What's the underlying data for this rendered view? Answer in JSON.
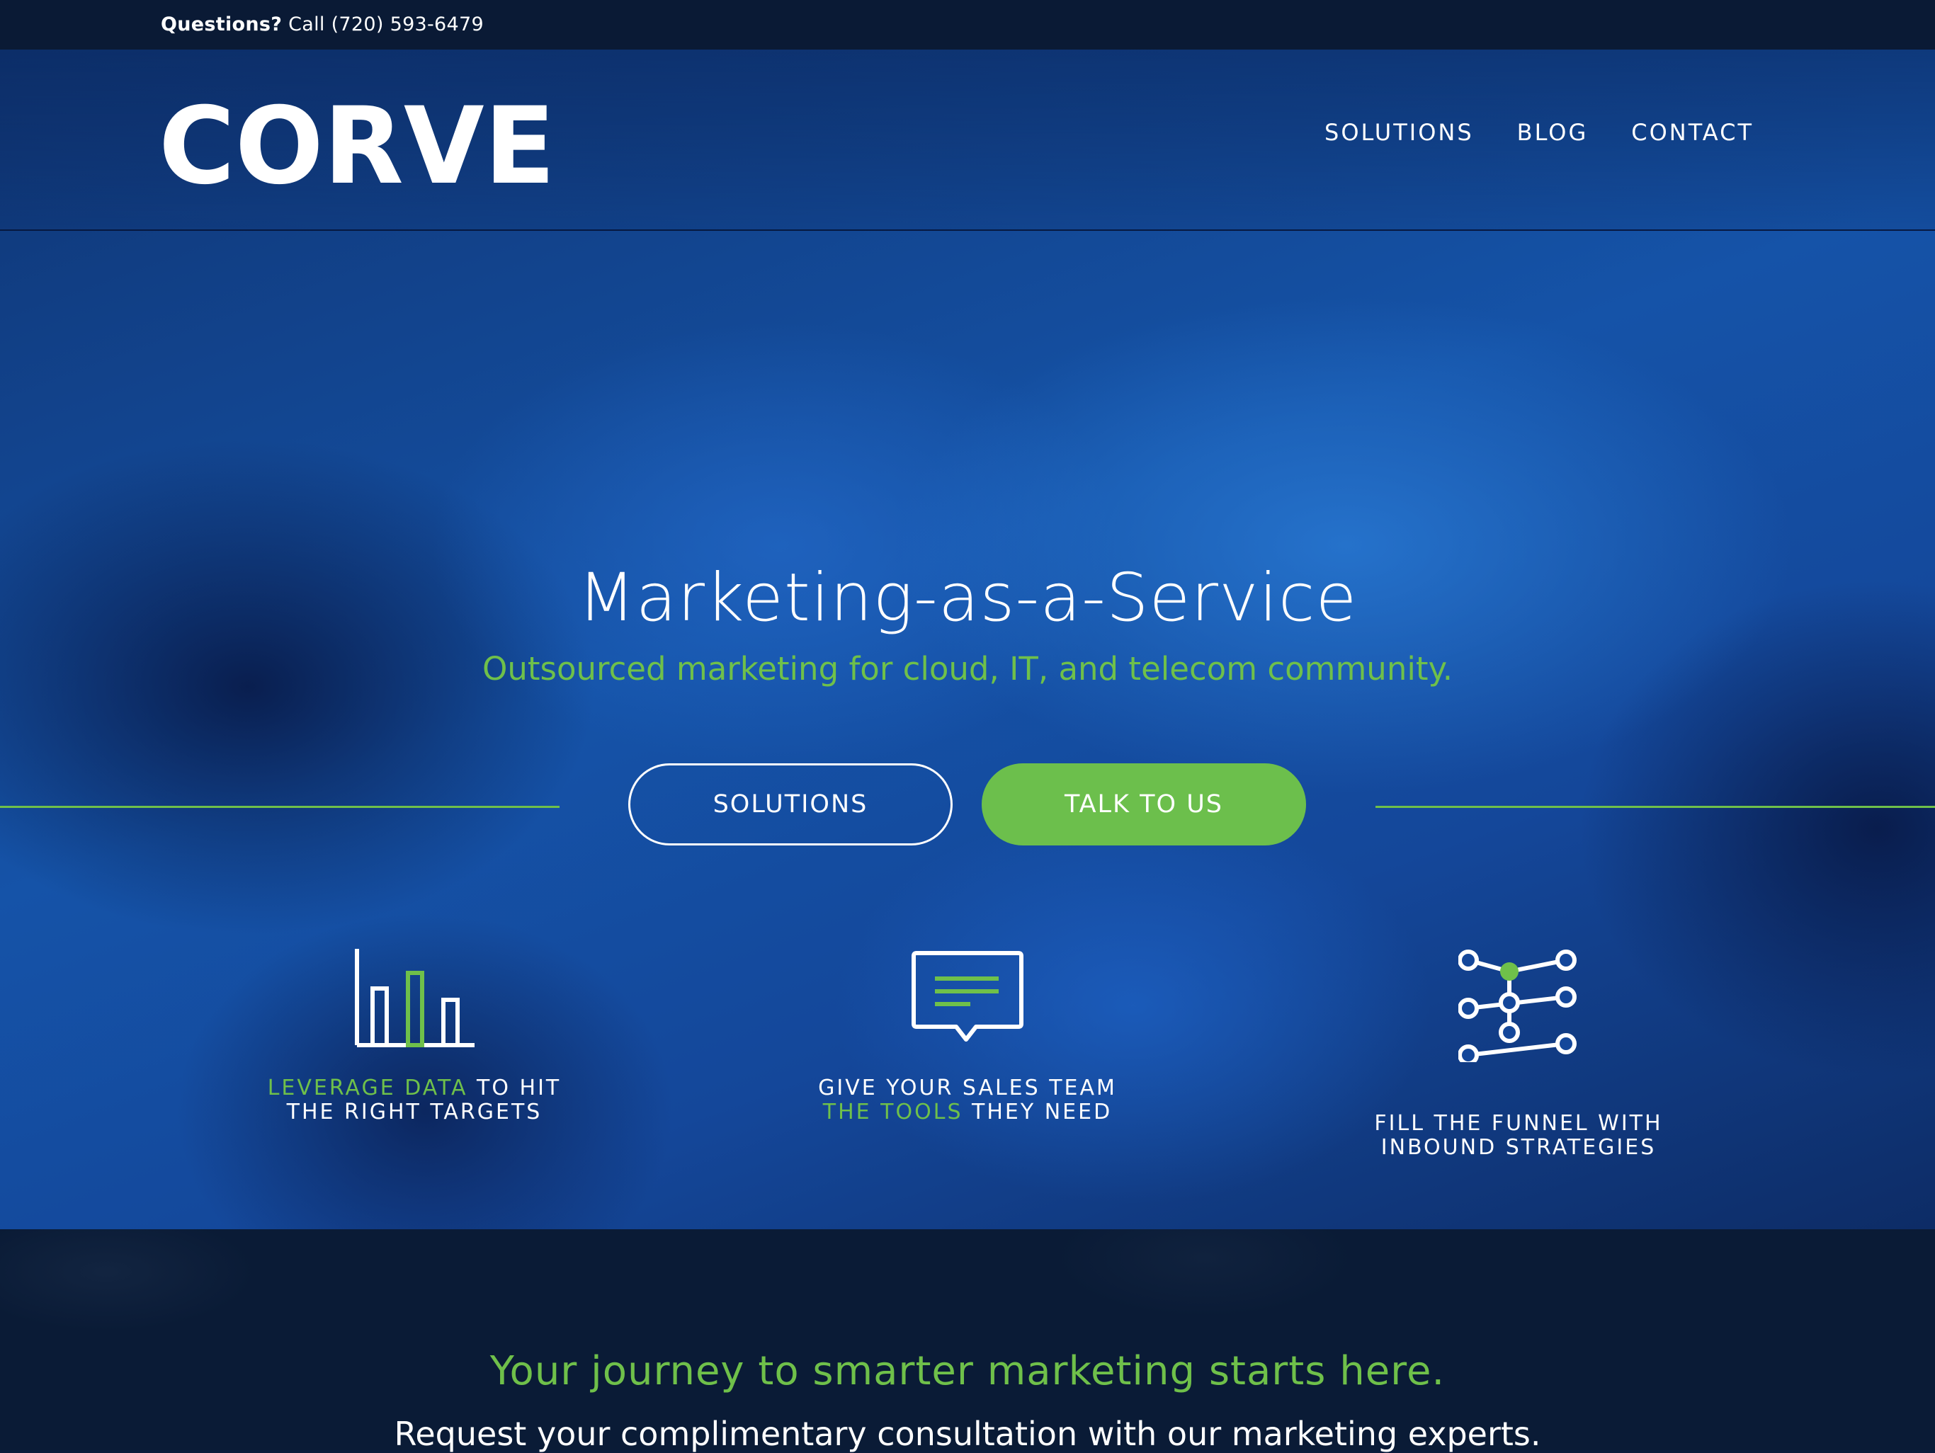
{
  "topbar": {
    "question_label": "Questions?",
    "call_text": " Call (720) 593-6479"
  },
  "header": {
    "logo_text": "CORVE",
    "nav": [
      {
        "label": "SOLUTIONS"
      },
      {
        "label": "BLOG"
      },
      {
        "label": "CONTACT"
      }
    ]
  },
  "hero": {
    "headline": "Marketing-as-a-Service",
    "subheadline": "Outsourced marketing for cloud, IT, and telecom community.",
    "buttons": {
      "solutions": "SOLUTIONS",
      "talk": "TALK TO US"
    }
  },
  "features": [
    {
      "icon": "bar-chart-icon",
      "line1_green": "LEVERAGE DATA",
      "line1_white": " TO HIT",
      "line2": "THE RIGHT TARGETS"
    },
    {
      "icon": "chat-bubble-icon",
      "line1": "GIVE YOUR SALES TEAM",
      "line2_green": "THE TOOLS",
      "line2_white": " THEY NEED"
    },
    {
      "icon": "network-nodes-icon",
      "line1": "FILL THE FUNNEL WITH",
      "line2_green": "INBOUND STRATEGIES"
    }
  ],
  "lower": {
    "title": "Your journey to smarter marketing starts here.",
    "subtitle": "Request your complimentary consultation with our marketing experts."
  },
  "colors": {
    "accent_green": "#6fc04a",
    "navy": "#0a1b36",
    "hero_blue": "#1553a8"
  }
}
